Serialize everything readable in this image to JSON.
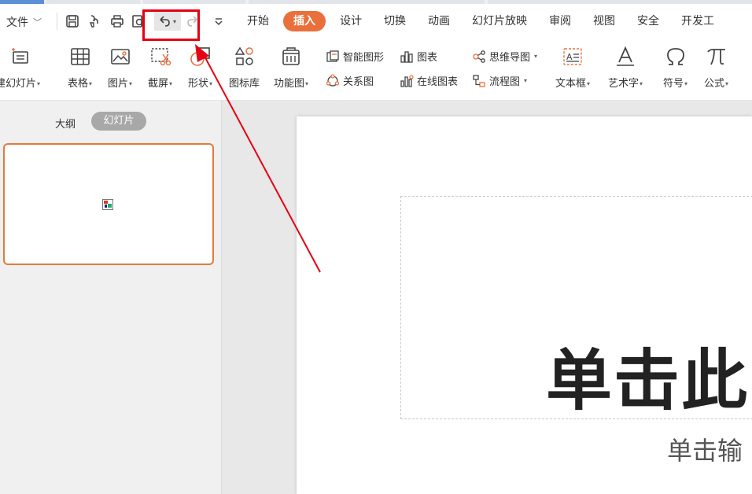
{
  "menu": {
    "file_label": "文件",
    "tabs": [
      {
        "label": "开始",
        "active": false
      },
      {
        "label": "插入",
        "active": true
      },
      {
        "label": "设计",
        "active": false
      },
      {
        "label": "切换",
        "active": false
      },
      {
        "label": "动画",
        "active": false
      },
      {
        "label": "幻灯片放映",
        "active": false
      },
      {
        "label": "审阅",
        "active": false
      },
      {
        "label": "视图",
        "active": false
      },
      {
        "label": "安全",
        "active": false
      },
      {
        "label": "开发工",
        "active": false
      }
    ]
  },
  "quick_access": [
    "save-icon",
    "format-painter-icon",
    "print-icon",
    "print-preview-icon",
    "undo-icon",
    "redo-icon",
    "customize-icon"
  ],
  "ribbon": {
    "new_slide": "建幻灯片",
    "table": "表格",
    "picture": "图片",
    "screenshot": "截屏",
    "shape": "形状",
    "icon_library": "图标库",
    "function_chart": "功能图",
    "smart_art": "智能图形",
    "chart": "图表",
    "relation_chart": "关系图",
    "online_chart": "在线图表",
    "mind_map": "思维导图",
    "flowchart": "流程图",
    "textbox": "文本框",
    "art_text": "艺术字",
    "symbol": "符号",
    "formula": "公式"
  },
  "side_panel": {
    "outline_label": "大纲",
    "slides_label": "幻灯片"
  },
  "slide": {
    "title": "单击此",
    "subtitle": "单击输"
  },
  "colors": {
    "accent": "#e9703c",
    "thumb_border": "#e07b39",
    "annotation": "#e60012"
  }
}
